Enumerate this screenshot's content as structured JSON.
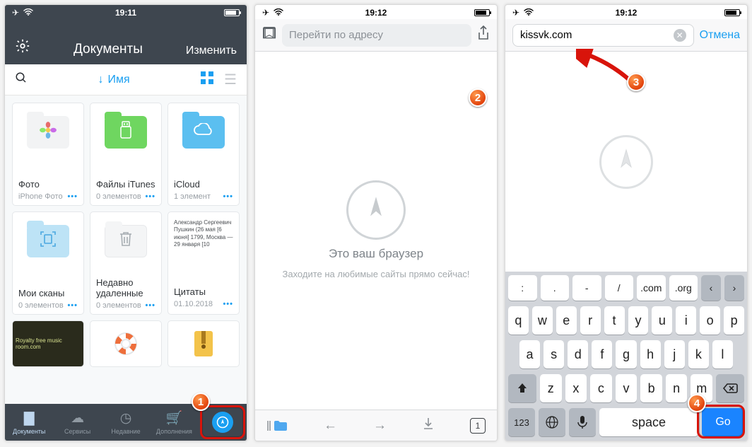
{
  "status": {
    "time1": "19:11",
    "time2": "19:12",
    "time3": "19:12"
  },
  "p1": {
    "title": "Документы",
    "edit": "Изменить",
    "sort_label": "Имя",
    "tiles": [
      {
        "name": "Фото",
        "sub": "iPhone Фото"
      },
      {
        "name": "Файлы iTunes",
        "sub": "0 элементов"
      },
      {
        "name": "iCloud",
        "sub": "1 элемент"
      },
      {
        "name": "Мои сканы",
        "sub": "0 элементов"
      },
      {
        "name": "Недавно удаленные",
        "sub": "0 элементов"
      },
      {
        "name": "Цитаты",
        "sub": "01.10.2018",
        "note": "Александр Сергеевич Пушкин (26 мая [6 июня] 1799, Москва — 29 января [10"
      }
    ],
    "tabs": [
      "Документы",
      "Сервисы",
      "Недавние",
      "Дополнения",
      ""
    ]
  },
  "p2": {
    "placeholder": "Перейти по адресу",
    "title": "Это ваш браузер",
    "subtitle": "Заходите на любимые сайты прямо сейчас!",
    "tab_count": "1"
  },
  "p3": {
    "url": "kissvk.com",
    "cancel": "Отмена",
    "kb_top": [
      ":",
      ".",
      "-",
      "/",
      ".com",
      ".org"
    ],
    "kb_r1": [
      "q",
      "w",
      "e",
      "r",
      "t",
      "y",
      "u",
      "i",
      "o",
      "p"
    ],
    "kb_r2": [
      "a",
      "s",
      "d",
      "f",
      "g",
      "h",
      "j",
      "k",
      "l"
    ],
    "kb_r3": [
      "z",
      "x",
      "c",
      "v",
      "b",
      "n",
      "m"
    ],
    "space": "space",
    "go": "Go",
    "n123": "123"
  },
  "badges": {
    "b1": "1",
    "b2": "2",
    "b3": "3",
    "b4": "4"
  }
}
